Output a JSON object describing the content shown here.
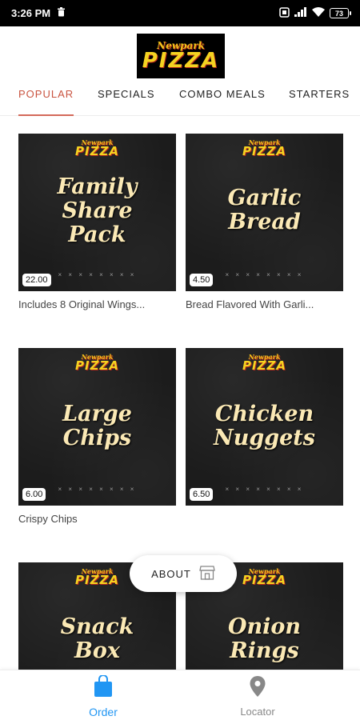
{
  "status_bar": {
    "time": "3:26 PM",
    "battery": "73"
  },
  "header": {
    "logo_small": "Newpark",
    "logo_big": "PIZZA"
  },
  "tabs": [
    {
      "label": "POPULAR",
      "active": true
    },
    {
      "label": "SPECIALS",
      "active": false
    },
    {
      "label": "COMBO MEALS",
      "active": false
    },
    {
      "label": "STARTERS",
      "active": false
    }
  ],
  "items": [
    {
      "title_lines": [
        "Family",
        "Share",
        "Pack"
      ],
      "price": "22.00",
      "description": "Includes 8 Original Wings..."
    },
    {
      "title_lines": [
        "Garlic",
        "Bread"
      ],
      "price": "4.50",
      "description": "Bread Flavored With Garli..."
    },
    {
      "title_lines": [
        "Large",
        "Chips"
      ],
      "price": "6.00",
      "description": "Crispy Chips"
    },
    {
      "title_lines": [
        "Chicken",
        "Nuggets"
      ],
      "price": "6.50",
      "description": ""
    },
    {
      "title_lines": [
        "Snack",
        "Box"
      ],
      "price": "",
      "description": ""
    },
    {
      "title_lines": [
        "Onion",
        "Rings"
      ],
      "price": "",
      "description": ""
    }
  ],
  "about_button": {
    "label": "ABOUT",
    "icon": "store-icon"
  },
  "bottom_nav": {
    "order": {
      "label": "Order",
      "icon": "shopping-bag-icon"
    },
    "locator": {
      "label": "Locator",
      "icon": "location-pin-icon"
    }
  },
  "colors": {
    "accent": "#c9533f",
    "nav_active": "#2196f3",
    "card_bg": "#1c1c1c",
    "logo_yellow": "#f5d321"
  }
}
